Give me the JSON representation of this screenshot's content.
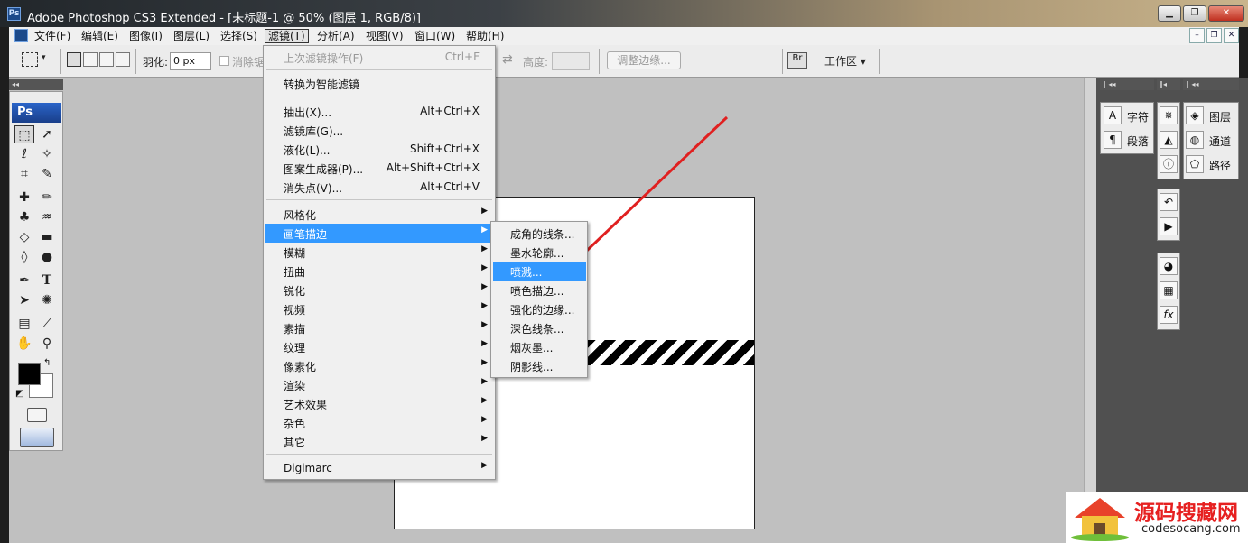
{
  "window": {
    "title": "Adobe Photoshop CS3 Extended - [未标题-1 @ 50% (图层 1, RGB/8)]",
    "app_icon": "Ps"
  },
  "menubar": {
    "items": [
      "文件(F)",
      "编辑(E)",
      "图像(I)",
      "图层(L)",
      "选择(S)",
      "滤镜(T)",
      "分析(A)",
      "视图(V)",
      "窗口(W)",
      "帮助(H)"
    ],
    "active": "滤镜(T)"
  },
  "options": {
    "feather_label": "羽化:",
    "feather_value": "0 px",
    "antialias_label": "消除锯齿",
    "height_label": "高度:",
    "refine_edge": "调整边缘...",
    "workspace": "工作区"
  },
  "filter_menu": {
    "items": [
      {
        "label": "上次滤镜操作(F)",
        "shortcut": "Ctrl+F",
        "disabled": true
      },
      {
        "label": "转换为智能滤镜"
      },
      {
        "label": "抽出(X)...",
        "shortcut": "Alt+Ctrl+X"
      },
      {
        "label": "滤镜库(G)..."
      },
      {
        "label": "液化(L)...",
        "shortcut": "Shift+Ctrl+X"
      },
      {
        "label": "图案生成器(P)...",
        "shortcut": "Alt+Shift+Ctrl+X"
      },
      {
        "label": "消失点(V)...",
        "shortcut": "Alt+Ctrl+V"
      },
      {
        "label": "风格化",
        "submenu": true
      },
      {
        "label": "画笔描边",
        "submenu": true,
        "highlighted": true
      },
      {
        "label": "模糊",
        "submenu": true
      },
      {
        "label": "扭曲",
        "submenu": true
      },
      {
        "label": "锐化",
        "submenu": true
      },
      {
        "label": "视频",
        "submenu": true
      },
      {
        "label": "素描",
        "submenu": true
      },
      {
        "label": "纹理",
        "submenu": true
      },
      {
        "label": "像素化",
        "submenu": true
      },
      {
        "label": "渲染",
        "submenu": true
      },
      {
        "label": "艺术效果",
        "submenu": true
      },
      {
        "label": "杂色",
        "submenu": true
      },
      {
        "label": "其它",
        "submenu": true
      },
      {
        "label": "Digimarc",
        "submenu": true
      }
    ]
  },
  "brush_submenu": {
    "items": [
      "成角的线条...",
      "墨水轮廓...",
      "喷溅...",
      "喷色描边...",
      "强化的边缘...",
      "深色线条...",
      "烟灰墨...",
      "阴影线..."
    ],
    "highlighted": "喷溅..."
  },
  "panels": {
    "text": [
      "字符",
      "段落"
    ],
    "layers": [
      "图层",
      "通道",
      "路径"
    ]
  },
  "watermark": {
    "title": "源码搜藏网",
    "url": "codesocang.com"
  },
  "colors": {
    "highlight": "#3399ff",
    "arrow": "#e02020",
    "foreground": "#000000",
    "background": "#ffffff"
  }
}
